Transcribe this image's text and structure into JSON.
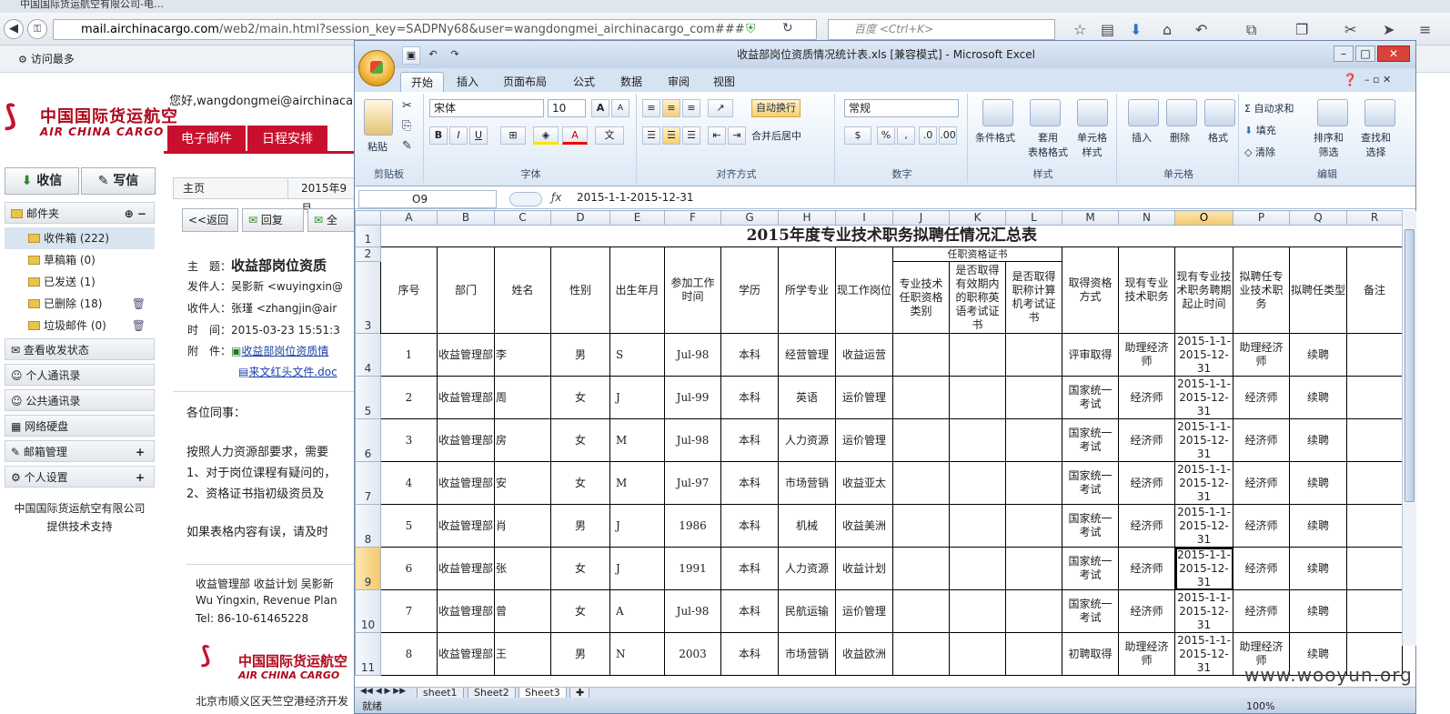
{
  "browser": {
    "title": "中国国际货运航空有限公司-电…",
    "url_domain": "mail.airchinacargo.com",
    "url_path": "/web2/main.html?session_key=SADPNy68&user=wangdongmei_airchinacargo_com###",
    "search_placeholder": "百度 <Ctrl+K>",
    "bookmark_label": "访问最多"
  },
  "mail": {
    "logo_zh": "中国国际货运航空",
    "logo_en": "AIR CHINA CARGO",
    "greeting": "您好,wangdongmei@airchinaca",
    "nav": [
      "电子邮件",
      "日程安排"
    ],
    "receive_btn": "收信",
    "compose_btn": "写信",
    "folders_label": "邮件夹",
    "folders": [
      {
        "label": "收件箱 (222)"
      },
      {
        "label": "草稿箱 (0)"
      },
      {
        "label": "已发送 (1)"
      },
      {
        "label": "已删除 (18)"
      },
      {
        "label": "垃圾邮件 (0)"
      }
    ],
    "sections": [
      "查看收发状态",
      "个人通讯录",
      "公共通讯录",
      "网络硬盘",
      "邮箱管理",
      "个人设置"
    ],
    "footer_line1": "中国国际货运航空有限公司",
    "footer_line2": "提供技术支持",
    "tab_home": "主页",
    "tab_date": "2015年9月",
    "back_btn": "<<返回",
    "reply_btn": "回复",
    "replyall_btn": "全",
    "subject_label": "主　题：",
    "subject": "收益部岗位资质",
    "from_label": "发件人：",
    "from": "吴影新 <wuyingxin@",
    "to_label": "收件人：",
    "to": "张瑾 <zhangjin@air",
    "time_label": "时　间：",
    "time": "2015-03-23 15:51:3",
    "attach_label": "附　件：",
    "attach1": "收益部岗位资质情",
    "attach2": "来文红头文件.doc",
    "body_greeting": "各位同事：",
    "body_p1": "按照人力资源部要求，需要",
    "body_p2": "1、对于岗位课程有疑问的，",
    "body_p3": "2、资格证书指初级资员及",
    "body_p4": "如果表格内容有误，请及时",
    "sig1": "收益管理部 收益计划 吴影新",
    "sig2": "Wu Yingxin,  Revenue Plan",
    "sig3": "Tel: 86-10-61465228",
    "sig_logo_zh": "中国国际货运航空",
    "sig_logo_en": "AIR CHINA CARGO",
    "sig_addr": "北京市顺义区天竺空港经济开发"
  },
  "excel": {
    "title": "收益部岗位资质情况统计表.xls  [兼容模式] - Microsoft Excel",
    "tabs": [
      "开始",
      "插入",
      "页面布局",
      "公式",
      "数据",
      "审阅",
      "视图"
    ],
    "font_name": "宋体",
    "font_size": "10",
    "number_format": "常规",
    "ribbon": {
      "paste": "粘贴",
      "wrap": "自动换行",
      "merge": "合并后居中",
      "cond_format": "条件格式",
      "table_format": "套用\n表格格式",
      "cell_style": "单元格\n样式",
      "insert": "插入",
      "delete": "删除",
      "format": "格式",
      "autosum": "自动求和",
      "fill": "填充",
      "clear": "清除",
      "sort": "排序和\n筛选",
      "find": "查找和\n选择"
    },
    "groups": [
      "剪贴板",
      "字体",
      "对齐方式",
      "数字",
      "样式",
      "单元格",
      "编辑"
    ],
    "namebox": "O9",
    "formula": "2015-1-1-2015-12-31",
    "columns": [
      "A",
      "B",
      "C",
      "D",
      "E",
      "F",
      "G",
      "H",
      "I",
      "J",
      "K",
      "L",
      "M",
      "N",
      "O",
      "P",
      "Q",
      "R"
    ],
    "selected_col": "O",
    "selected_row": "9",
    "sheet_title": "2015年度专业技术职务拟聘任情况汇总表",
    "group_header": "任职资格证书",
    "headers": [
      "序号",
      "部门",
      "姓名",
      "性别",
      "出生年月",
      "参加工作时间",
      "学历",
      "所学专业",
      "现工作岗位",
      "专业技术任职资格类别",
      "是否取得有效期内的职称英语考试证书",
      "是否取得职称计算机考试证书",
      "取得资格方式",
      "现有专业技术职务",
      "现有专业技术职务聘期起止时间",
      "拟聘任专业技术职务",
      "拟聘任类型",
      "备注"
    ],
    "rows": [
      {
        "rn": "4",
        "c": [
          "1",
          "收益管理部",
          "李",
          "男",
          "S",
          "Jul-98",
          "本科",
          "经营管理",
          "收益运营",
          "",
          "",
          "",
          "评审取得",
          "助理经济师",
          "2015-1-1-2015-12-31",
          "助理经济师",
          "续聘",
          ""
        ]
      },
      {
        "rn": "5",
        "c": [
          "2",
          "收益管理部",
          "周",
          "女",
          "J",
          "Jul-99",
          "本科",
          "英语",
          "运价管理",
          "",
          "",
          "",
          "国家统一考试",
          "经济师",
          "2015-1-1-2015-12-31",
          "经济师",
          "续聘",
          ""
        ]
      },
      {
        "rn": "6",
        "c": [
          "3",
          "收益管理部",
          "房",
          "女",
          "M",
          "Jul-98",
          "本科",
          "人力资源",
          "运价管理",
          "",
          "",
          "",
          "国家统一考试",
          "经济师",
          "2015-1-1-2015-12-31",
          "经济师",
          "续聘",
          ""
        ]
      },
      {
        "rn": "7",
        "c": [
          "4",
          "收益管理部",
          "安",
          "女",
          "M",
          "Jul-97",
          "本科",
          "市场营销",
          "收益亚太",
          "",
          "",
          "",
          "国家统一考试",
          "经济师",
          "2015-1-1-2015-12-31",
          "经济师",
          "续聘",
          ""
        ]
      },
      {
        "rn": "8",
        "c": [
          "5",
          "收益管理部",
          "肖",
          "男",
          "J",
          "1986",
          "本科",
          "机械",
          "收益美洲",
          "",
          "",
          "",
          "国家统一考试",
          "经济师",
          "2015-1-1-2015-12-31",
          "经济师",
          "续聘",
          ""
        ]
      },
      {
        "rn": "9",
        "c": [
          "6",
          "收益管理部",
          "张",
          "女",
          "J",
          "1991",
          "本科",
          "人力资源",
          "收益计划",
          "",
          "",
          "",
          "国家统一考试",
          "经济师",
          "2015-1-1-2015-12-31",
          "经济师",
          "续聘",
          ""
        ]
      },
      {
        "rn": "10",
        "c": [
          "7",
          "收益管理部",
          "曾",
          "女",
          "A",
          "Jul-98",
          "本科",
          "民航运输",
          "运价管理",
          "",
          "",
          "",
          "国家统一考试",
          "经济师",
          "2015-1-1-2015-12-31",
          "经济师",
          "续聘",
          ""
        ]
      },
      {
        "rn": "11",
        "c": [
          "8",
          "收益管理部",
          "王",
          "男",
          "N",
          "2003",
          "本科",
          "市场营销",
          "收益欧洲",
          "",
          "",
          "",
          "初聘取得",
          "助理经济师",
          "2015-1-1-2015-12-31",
          "助理经济师",
          "续聘",
          ""
        ]
      }
    ],
    "sheets": [
      "sheet1",
      "Sheet2",
      "Sheet3"
    ],
    "status": "就绪",
    "zoom": "100%"
  },
  "watermark": "www.wooyun.org"
}
